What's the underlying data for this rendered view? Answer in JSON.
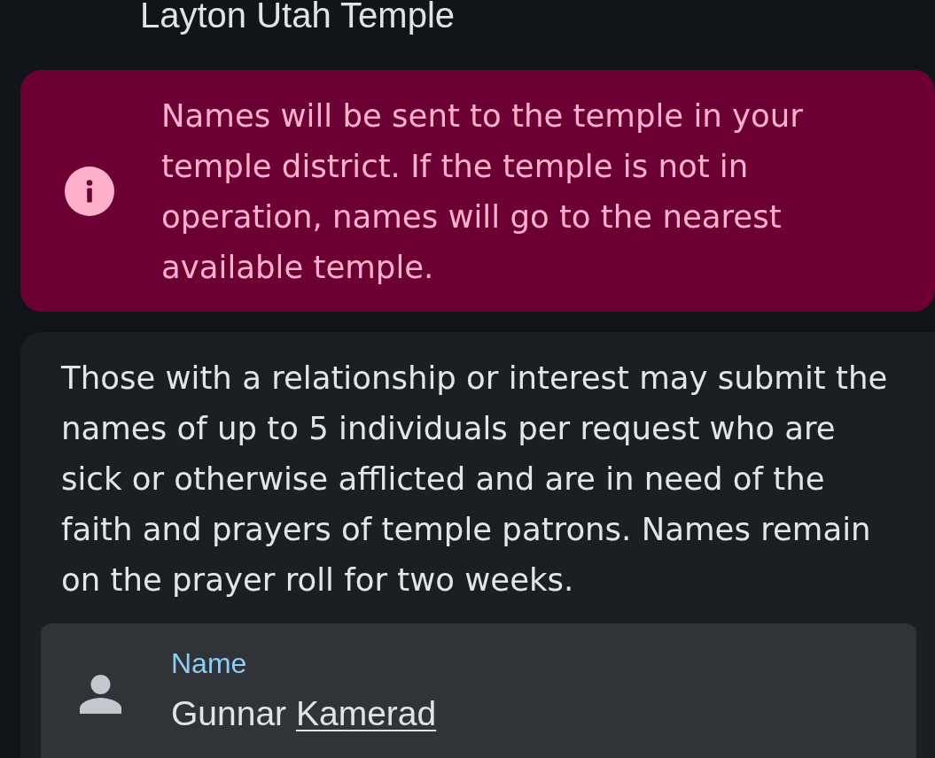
{
  "header": {
    "title": "Layton Utah Temple"
  },
  "notice": {
    "text": "Names will be sent to the temple in your temple district. If the temple is not in operation, names will go to the nearest available temple."
  },
  "request_card": {
    "description": "Those with a relationship or interest may submit the names of up to 5 individuals per request who are sick or otherwise afflicted and are in need of the faith and prayers of temple patrons. Names remain on the prayer roll for two weeks.",
    "name_field": {
      "label": "Name",
      "value_parts": [
        {
          "text": "Gunnar",
          "underlined": false
        },
        {
          "text": "Kamerad",
          "underlined": true
        }
      ]
    }
  }
}
